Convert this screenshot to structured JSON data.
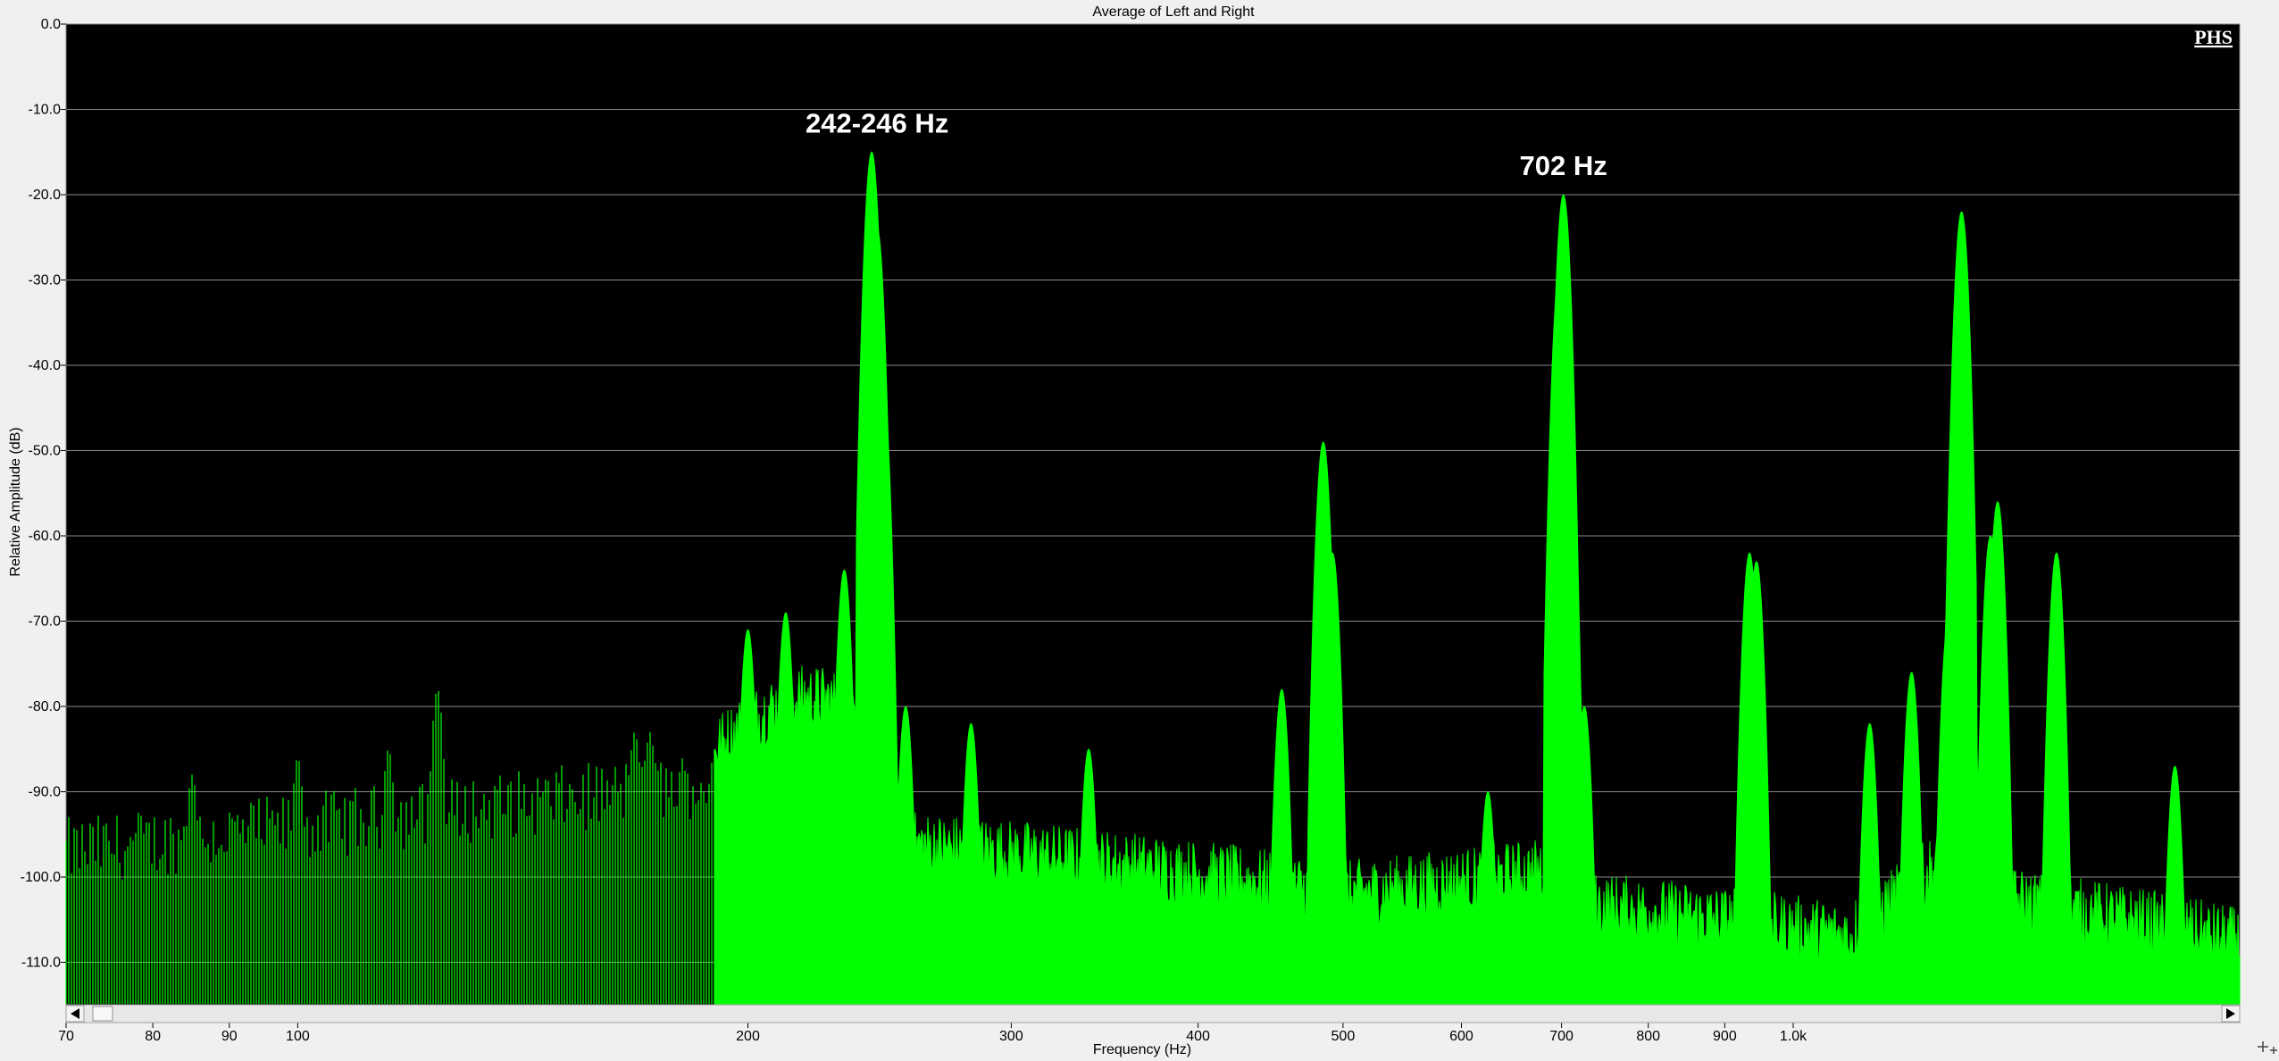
{
  "window": {
    "badge": "PHS"
  },
  "chart_data": {
    "type": "area",
    "title": "Average of Left and Right",
    "xlabel": "Frequency (Hz)",
    "ylabel": "Relative Amplitude (dB)",
    "xscale": "log",
    "xlim": [
      70,
      2300
    ],
    "ylim": [
      -115,
      0
    ],
    "grid": true,
    "series_color": "#00ff00",
    "background": "#000000",
    "x_ticks": [
      {
        "value": 70,
        "label": "70"
      },
      {
        "value": 80,
        "label": "80"
      },
      {
        "value": 90,
        "label": "90"
      },
      {
        "value": 100,
        "label": "100"
      },
      {
        "value": 200,
        "label": "200"
      },
      {
        "value": 300,
        "label": "300"
      },
      {
        "value": 400,
        "label": "400"
      },
      {
        "value": 500,
        "label": "500"
      },
      {
        "value": 600,
        "label": "600"
      },
      {
        "value": 700,
        "label": "700"
      },
      {
        "value": 800,
        "label": "800"
      },
      {
        "value": 900,
        "label": "900"
      },
      {
        "value": 1000,
        "label": "1.0k"
      }
    ],
    "y_ticks": [
      {
        "value": 0,
        "label": "0.0"
      },
      {
        "value": -10,
        "label": "-10.0"
      },
      {
        "value": -20,
        "label": "-20.0"
      },
      {
        "value": -30,
        "label": "-30.0"
      },
      {
        "value": -40,
        "label": "-40.0"
      },
      {
        "value": -50,
        "label": "-50.0"
      },
      {
        "value": -60,
        "label": "-60.0"
      },
      {
        "value": -70,
        "label": "-70.0"
      },
      {
        "value": -80,
        "label": "-80.0"
      },
      {
        "value": -90,
        "label": "-90.0"
      },
      {
        "value": -100,
        "label": "-100.0"
      },
      {
        "value": -110,
        "label": "-110.0"
      }
    ],
    "peaks": [
      {
        "x": 85,
        "y": -88
      },
      {
        "x": 100,
        "y": -86
      },
      {
        "x": 115,
        "y": -85
      },
      {
        "x": 124,
        "y": -78
      },
      {
        "x": 168,
        "y": -83
      },
      {
        "x": 172,
        "y": -83
      },
      {
        "x": 190,
        "y": -85
      },
      {
        "x": 200,
        "y": -71
      },
      {
        "x": 212,
        "y": -69
      },
      {
        "x": 232,
        "y": -64
      },
      {
        "x": 242,
        "y": -15
      },
      {
        "x": 244,
        "y": -24
      },
      {
        "x": 246,
        "y": -42
      },
      {
        "x": 255,
        "y": -80
      },
      {
        "x": 282,
        "y": -82
      },
      {
        "x": 338,
        "y": -85
      },
      {
        "x": 455,
        "y": -78
      },
      {
        "x": 485,
        "y": -49
      },
      {
        "x": 492,
        "y": -62
      },
      {
        "x": 625,
        "y": -90
      },
      {
        "x": 698,
        "y": -29
      },
      {
        "x": 702,
        "y": -20
      },
      {
        "x": 706,
        "y": -40
      },
      {
        "x": 725,
        "y": -80
      },
      {
        "x": 935,
        "y": -62
      },
      {
        "x": 945,
        "y": -63
      },
      {
        "x": 1125,
        "y": -82
      },
      {
        "x": 1200,
        "y": -76
      },
      {
        "x": 1270,
        "y": -70
      },
      {
        "x": 1296,
        "y": -22
      },
      {
        "x": 1300,
        "y": -48
      },
      {
        "x": 1355,
        "y": -60
      },
      {
        "x": 1370,
        "y": -56
      },
      {
        "x": 1500,
        "y": -62
      },
      {
        "x": 1800,
        "y": -87
      }
    ],
    "annotations": [
      {
        "x": 244,
        "y": -15,
        "text": "242-246 Hz"
      },
      {
        "x": 702,
        "y": -20,
        "text": "702 Hz"
      }
    ]
  }
}
